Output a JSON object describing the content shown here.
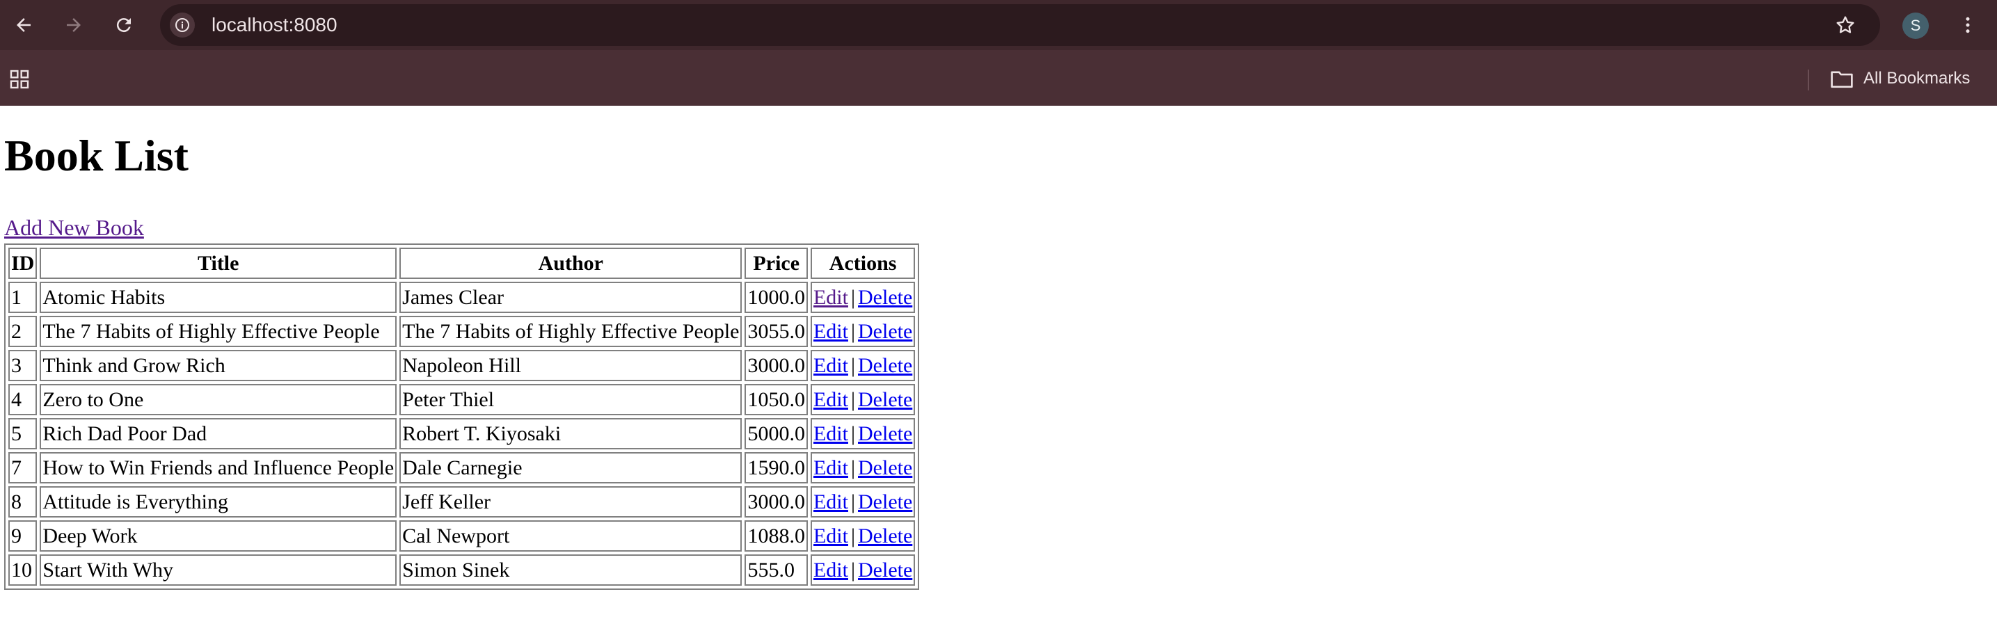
{
  "browser": {
    "url": "localhost:8080",
    "profile_initial": "S",
    "bookmarks_label": "All Bookmarks",
    "icons": [
      "back-icon",
      "forward-icon",
      "reload-icon",
      "site-info-icon",
      "star-icon",
      "menu-dots-icon",
      "apps-icon",
      "folder-icon"
    ]
  },
  "page": {
    "heading": "Book List",
    "add_link": "Add New Book"
  },
  "table": {
    "headers": {
      "id": "ID",
      "title": "Title",
      "author": "Author",
      "price": "Price",
      "actions": "Actions"
    },
    "rows": [
      {
        "id": "1",
        "title": "Atomic Habits",
        "author": "James Clear",
        "price": "1000.0",
        "edit": "Edit",
        "sep": "|",
        "delete": "Delete"
      },
      {
        "id": "2",
        "title": "The 7 Habits of Highly Effective People",
        "author": "The 7 Habits of Highly Effective People",
        "price": "3055.0",
        "edit": "Edit",
        "sep": "|",
        "delete": "Delete"
      },
      {
        "id": "3",
        "title": "Think and Grow Rich",
        "author": "Napoleon Hill",
        "price": "3000.0",
        "edit": "Edit",
        "sep": "|",
        "delete": "Delete"
      },
      {
        "id": "4",
        "title": "Zero to One",
        "author": "Peter Thiel",
        "price": "1050.0",
        "edit": "Edit",
        "sep": "|",
        "delete": "Delete"
      },
      {
        "id": "5",
        "title": "Rich Dad Poor Dad",
        "author": "Robert T. Kiyosaki",
        "price": "5000.0",
        "edit": "Edit",
        "sep": "|",
        "delete": "Delete"
      },
      {
        "id": "7",
        "title": "How to Win Friends and Influence People",
        "author": "Dale Carnegie",
        "price": "1590.0",
        "edit": "Edit",
        "sep": "|",
        "delete": "Delete"
      },
      {
        "id": "8",
        "title": "Attitude is Everything",
        "author": "Jeff Keller",
        "price": "3000.0",
        "edit": "Edit",
        "sep": "|",
        "delete": "Delete"
      },
      {
        "id": "9",
        "title": "Deep Work",
        "author": "Cal Newport",
        "price": "1088.0",
        "edit": "Edit",
        "sep": "|",
        "delete": "Delete"
      },
      {
        "id": "10",
        "title": "Start With Why",
        "author": "Simon Sinek",
        "price": "555.0",
        "edit": "Edit",
        "sep": "|",
        "delete": "Delete"
      }
    ]
  },
  "colors": {
    "chrome_toolbar": "#3f272c",
    "chrome_bookmarks": "#4a2f35",
    "link": "#0000ee",
    "visited_link": "#551a8b"
  }
}
